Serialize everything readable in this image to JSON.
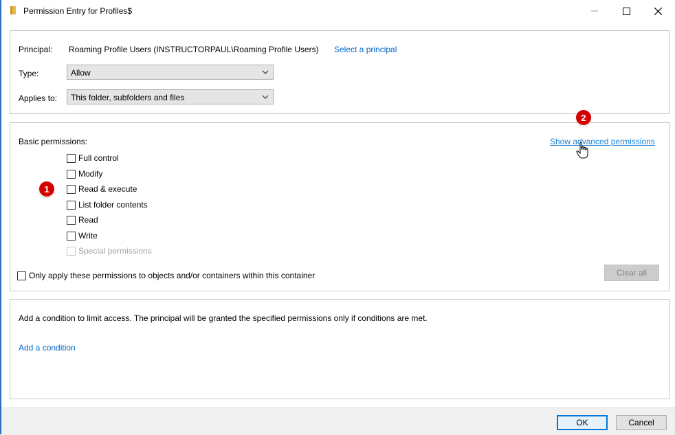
{
  "window": {
    "title": "Permission Entry for Profiles$",
    "controls": {
      "minimize": "—",
      "maximize": "□",
      "close": "✕"
    }
  },
  "principal": {
    "label": "Principal:",
    "value": "Roaming Profile Users (INSTRUCTORPAUL\\Roaming Profile Users)",
    "select_link": "Select a principal"
  },
  "type": {
    "label": "Type:",
    "selected": "Allow"
  },
  "applies_to": {
    "label": "Applies to:",
    "selected": "This folder, subfolders and files"
  },
  "permissions": {
    "heading": "Basic permissions:",
    "show_advanced_link": "Show advanced permissions",
    "items": [
      {
        "label": "Full control",
        "checked": false,
        "enabled": true
      },
      {
        "label": "Modify",
        "checked": false,
        "enabled": true
      },
      {
        "label": "Read & execute",
        "checked": false,
        "enabled": true
      },
      {
        "label": "List folder contents",
        "checked": false,
        "enabled": true
      },
      {
        "label": "Read",
        "checked": false,
        "enabled": true
      },
      {
        "label": "Write",
        "checked": false,
        "enabled": true
      },
      {
        "label": "Special permissions",
        "checked": false,
        "enabled": false
      }
    ],
    "only_apply_label": "Only apply these permissions to objects and/or containers within this container",
    "clear_all": "Clear all"
  },
  "condition": {
    "description": "Add a condition to limit access. The principal will be granted the specified permissions only if conditions are met.",
    "add_link": "Add a condition"
  },
  "markers": [
    "1",
    "2"
  ],
  "buttons": {
    "ok": "OK",
    "cancel": "Cancel"
  },
  "colors": {
    "link": "#0066cc",
    "marker": "#d40000",
    "accent": "#0078d7"
  }
}
